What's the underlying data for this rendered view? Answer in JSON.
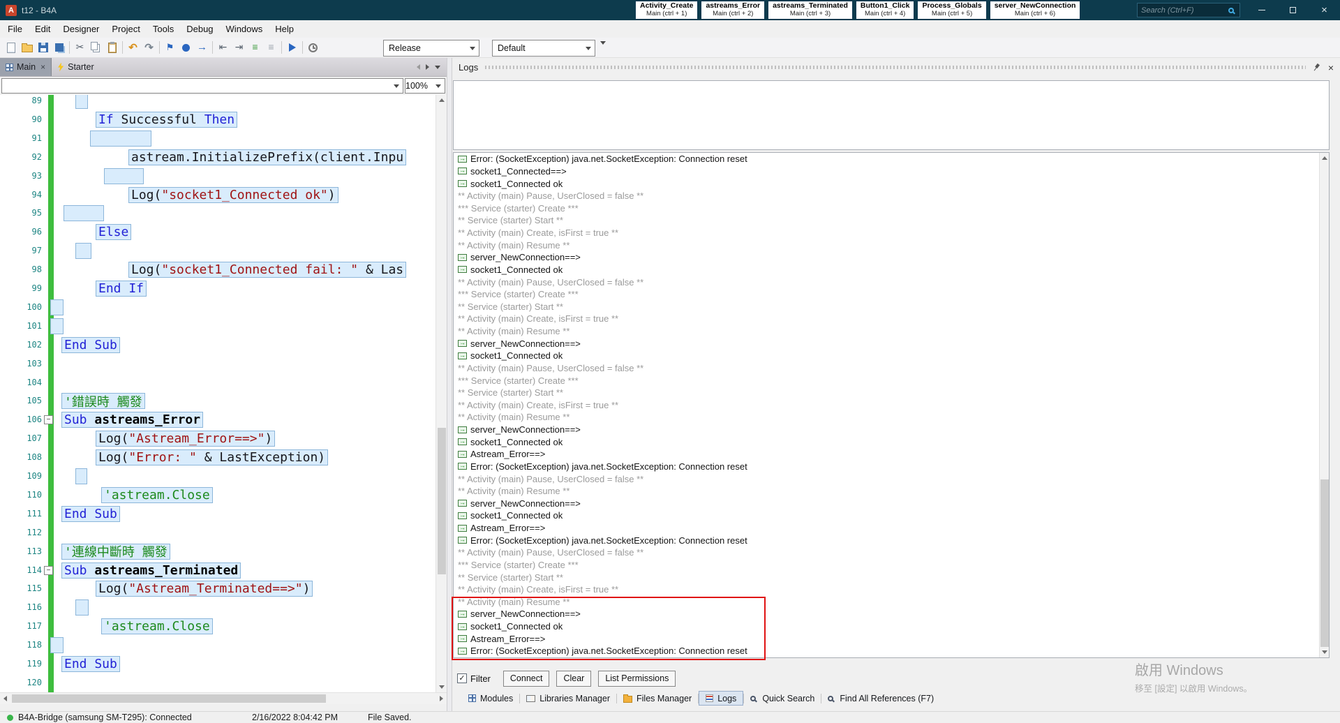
{
  "titlebar": {
    "app_initial": "A",
    "title": "t12 - B4A",
    "hotkey_tabs": [
      {
        "name": "Activity_Create",
        "sub": "Main (ctrl + 1)"
      },
      {
        "name": "astreams_Error",
        "sub": "Main (ctrl + 2)"
      },
      {
        "name": "astreams_Terminated",
        "sub": "Main (ctrl + 3)"
      },
      {
        "name": "Button1_Click",
        "sub": "Main (ctrl + 4)"
      },
      {
        "name": "Process_Globals",
        "sub": "Main (ctrl + 5)"
      },
      {
        "name": "server_NewConnection",
        "sub": "Main (ctrl + 6)"
      }
    ],
    "search_placeholder": "Search (Ctrl+F)"
  },
  "menubar": {
    "items": [
      "File",
      "Edit",
      "Designer",
      "Project",
      "Tools",
      "Debug",
      "Windows",
      "Help"
    ]
  },
  "toolbar": {
    "build_configuration": "Release",
    "log_filter": "Default",
    "icons": [
      {
        "name": "new-project-icon",
        "kind": "page"
      },
      {
        "name": "open-project-icon",
        "kind": "folder"
      },
      {
        "name": "save-icon",
        "kind": "floppy"
      },
      {
        "name": "save-all-icon",
        "kind": "floppy2"
      },
      {
        "kind": "sep"
      },
      {
        "name": "cut-icon",
        "kind": "cut"
      },
      {
        "name": "copy-icon",
        "kind": "copy"
      },
      {
        "name": "paste-icon",
        "kind": "clip"
      },
      {
        "kind": "sep"
      },
      {
        "name": "undo-icon",
        "kind": "undo"
      },
      {
        "name": "redo-icon",
        "kind": "redo"
      },
      {
        "kind": "sep"
      },
      {
        "name": "bookmark-icon",
        "kind": "flag"
      },
      {
        "name": "breakpoint-icon",
        "kind": "dot"
      },
      {
        "name": "goto-icon",
        "kind": "arrow"
      },
      {
        "kind": "sep"
      },
      {
        "name": "outdent-icon",
        "kind": "outdent"
      },
      {
        "name": "indent-icon",
        "kind": "indent"
      },
      {
        "name": "comment-icon",
        "kind": "cmt"
      },
      {
        "name": "uncomment-icon",
        "kind": "uncmt"
      },
      {
        "kind": "sep"
      },
      {
        "name": "run-icon",
        "kind": "play"
      },
      {
        "kind": "sep"
      },
      {
        "name": "clean-project-icon",
        "kind": "clock"
      }
    ]
  },
  "editor": {
    "tabs": [
      {
        "label": "Main"
      },
      {
        "label": "Starter"
      }
    ],
    "module_selector": "",
    "zoom": "100%",
    "lines": [
      {
        "n": 89,
        "ebox": [
          108,
          18
        ]
      },
      {
        "n": 90,
        "indent": 137,
        "seg": [
          [
            "kw",
            "If"
          ],
          [
            "tx",
            " Successful "
          ],
          [
            "kw",
            "Then"
          ]
        ]
      },
      {
        "n": 91,
        "ebox": [
          129,
          88
        ]
      },
      {
        "n": 92,
        "indent": 184,
        "seg": [
          [
            "tx",
            "astream.InitializePrefix(client.Inpu"
          ]
        ]
      },
      {
        "n": 93,
        "ebox": [
          149,
          57
        ]
      },
      {
        "n": 94,
        "indent": 184,
        "seg": [
          [
            "tx",
            "Log("
          ],
          [
            "st",
            "\"socket1_Connected ok\""
          ],
          [
            "tx",
            ")"
          ]
        ]
      },
      {
        "n": 95,
        "ebox": [
          91,
          58
        ]
      },
      {
        "n": 96,
        "indent": 137,
        "seg": [
          [
            "kw",
            "Else"
          ]
        ]
      },
      {
        "n": 97,
        "ebox": [
          108,
          23
        ]
      },
      {
        "n": 98,
        "indent": 184,
        "seg": [
          [
            "tx",
            "Log("
          ],
          [
            "st",
            "\"socket1_Connected fail: \""
          ],
          [
            "tx",
            " & Las"
          ]
        ]
      },
      {
        "n": 99,
        "indent": 137,
        "seg": [
          [
            "kw",
            "End If"
          ]
        ]
      },
      {
        "n": 100,
        "ebox": [
          72,
          19
        ]
      },
      {
        "n": 101,
        "ebox": [
          72,
          19
        ]
      },
      {
        "n": 102,
        "indent": 88,
        "seg": [
          [
            "kw",
            "End Sub"
          ]
        ]
      },
      {
        "n": 103
      },
      {
        "n": 104
      },
      {
        "n": 105,
        "indent": 88,
        "seg": [
          [
            "cm",
            "'錯誤時 觸發"
          ]
        ]
      },
      {
        "n": 106,
        "indent": 88,
        "collapse": true,
        "seg": [
          [
            "kw",
            "Sub"
          ],
          [
            "tx",
            " "
          ],
          [
            "nm",
            "astreams_Error"
          ]
        ]
      },
      {
        "n": 107,
        "indent": 137,
        "seg": [
          [
            "tx",
            "Log("
          ],
          [
            "st",
            "\"Astream_Error==>\""
          ],
          [
            "tx",
            ")"
          ]
        ]
      },
      {
        "n": 108,
        "indent": 137,
        "seg": [
          [
            "tx",
            "Log("
          ],
          [
            "st",
            "\"Error: \""
          ],
          [
            "tx",
            " & LastException)"
          ]
        ]
      },
      {
        "n": 109,
        "ebox": [
          108,
          17
        ]
      },
      {
        "n": 110,
        "indent": 145,
        "seg": [
          [
            "cm",
            "'astream.Close"
          ]
        ]
      },
      {
        "n": 111,
        "indent": 88,
        "seg": [
          [
            "kw",
            "End Sub"
          ]
        ]
      },
      {
        "n": 112
      },
      {
        "n": 113,
        "indent": 88,
        "seg": [
          [
            "cm",
            "'連線中斷時 觸發"
          ]
        ]
      },
      {
        "n": 114,
        "indent": 88,
        "collapse": true,
        "seg": [
          [
            "kw",
            "Sub"
          ],
          [
            "tx",
            " "
          ],
          [
            "nm",
            "astreams_Terminated"
          ]
        ]
      },
      {
        "n": 115,
        "indent": 137,
        "seg": [
          [
            "tx",
            "Log("
          ],
          [
            "st",
            "\"Astream_Terminated==>\""
          ],
          [
            "tx",
            ")"
          ]
        ]
      },
      {
        "n": 116,
        "ebox": [
          108,
          19
        ]
      },
      {
        "n": 117,
        "indent": 145,
        "seg": [
          [
            "cm",
            "'astream.Close"
          ]
        ]
      },
      {
        "n": 118,
        "ebox": [
          72,
          19
        ]
      },
      {
        "n": 119,
        "indent": 88,
        "seg": [
          [
            "kw",
            "End Sub"
          ]
        ]
      },
      {
        "n": 120
      }
    ]
  },
  "logs": {
    "panel_title": "Logs",
    "filter_label": "Filter",
    "filter_checked": true,
    "buttons": {
      "connect": "Connect",
      "clear": "Clear",
      "list_permissions": "List Permissions"
    },
    "entries": [
      {
        "i": 1,
        "t": "Error: (SocketException) java.net.SocketException: Connection reset"
      },
      {
        "i": 1,
        "t": "socket1_Connected==>"
      },
      {
        "i": 1,
        "t": "socket1_Connected ok"
      },
      {
        "t": "** Activity (main) Pause, UserClosed = false **"
      },
      {
        "t": "*** Service (starter) Create ***"
      },
      {
        "t": "** Service (starter) Start **"
      },
      {
        "t": "** Activity (main) Create, isFirst = true **"
      },
      {
        "t": "** Activity (main) Resume **"
      },
      {
        "i": 1,
        "t": "server_NewConnection==>"
      },
      {
        "i": 1,
        "t": "socket1_Connected ok"
      },
      {
        "t": "** Activity (main) Pause, UserClosed = false **"
      },
      {
        "t": "*** Service (starter) Create ***"
      },
      {
        "t": "** Service (starter) Start **"
      },
      {
        "t": "** Activity (main) Create, isFirst = true **"
      },
      {
        "t": "** Activity (main) Resume **"
      },
      {
        "i": 1,
        "t": "server_NewConnection==>"
      },
      {
        "i": 1,
        "t": "socket1_Connected ok"
      },
      {
        "t": "** Activity (main) Pause, UserClosed = false **"
      },
      {
        "t": "*** Service (starter) Create ***"
      },
      {
        "t": "** Service (starter) Start **"
      },
      {
        "t": "** Activity (main) Create, isFirst = true **"
      },
      {
        "t": "** Activity (main) Resume **"
      },
      {
        "i": 1,
        "t": "server_NewConnection==>"
      },
      {
        "i": 1,
        "t": "socket1_Connected ok"
      },
      {
        "i": 1,
        "t": "Astream_Error==>"
      },
      {
        "i": 1,
        "t": "Error: (SocketException) java.net.SocketException: Connection reset"
      },
      {
        "t": "** Activity (main) Pause, UserClosed = false **"
      },
      {
        "t": "** Activity (main) Resume **"
      },
      {
        "i": 1,
        "t": "server_NewConnection==>"
      },
      {
        "i": 1,
        "t": "socket1_Connected ok"
      },
      {
        "i": 1,
        "t": "Astream_Error==>"
      },
      {
        "i": 1,
        "t": "Error: (SocketException) java.net.SocketException: Connection reset"
      },
      {
        "t": "** Activity (main) Pause, UserClosed = false **"
      },
      {
        "t": "*** Service (starter) Create ***"
      },
      {
        "t": "** Service (starter) Start **"
      },
      {
        "t": "** Activity (main) Create, isFirst = true **"
      },
      {
        "t": "** Activity (main) Resume **"
      },
      {
        "i": 1,
        "t": "server_NewConnection==>",
        "h": 1
      },
      {
        "i": 1,
        "t": "socket1_Connected ok",
        "h": 1
      },
      {
        "i": 1,
        "t": "Astream_Error==>",
        "h": 1
      },
      {
        "i": 1,
        "t": "Error: (SocketException) java.net.SocketException: Connection reset",
        "h": 1
      }
    ]
  },
  "bottom_tabs": [
    {
      "label": "Modules",
      "icon": "modules-icon",
      "kind": "modules"
    },
    {
      "label": "Libraries Manager",
      "icon": "book-icon",
      "kind": "book"
    },
    {
      "label": "Files Manager",
      "icon": "folder-icon",
      "kind": "folder"
    },
    {
      "label": "Logs",
      "icon": "logs-icon",
      "kind": "logs",
      "selected": true
    },
    {
      "label": "Quick Search",
      "icon": "magnifier-icon",
      "kind": "mag"
    },
    {
      "label": "Find All References (F7)",
      "icon": "magnifier-icon",
      "kind": "mag"
    }
  ],
  "statusbar": {
    "connection": "B4A-Bridge (samsung SM-T295): Connected",
    "timestamp": "2/16/2022 8:04:42 PM",
    "file_status": "File Saved."
  },
  "watermark": {
    "line1": "啟用 Windows",
    "line2": "移至 [設定] 以啟用 Windows。"
  }
}
